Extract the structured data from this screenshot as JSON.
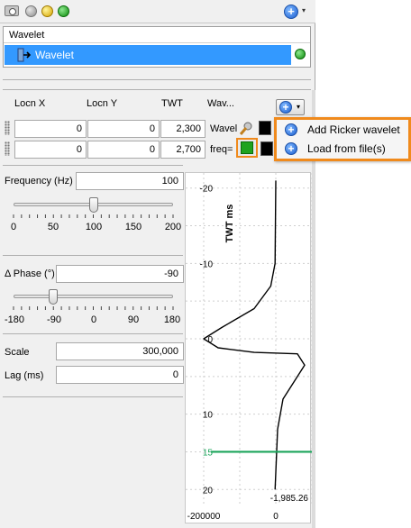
{
  "toolbar": {
    "add_label": "+",
    "dropdown_arrow": "▾"
  },
  "wavelet_list": {
    "header": "Wavelet",
    "items": [
      {
        "label": "Wavelet",
        "selected": true,
        "status": "green"
      }
    ]
  },
  "table": {
    "headers": [
      "Locn X",
      "Locn Y",
      "TWT",
      "Wav..."
    ],
    "rows": [
      {
        "x": "0",
        "y": "0",
        "twt": "2,300",
        "wav": "Wavel"
      },
      {
        "x": "0",
        "y": "0",
        "twt": "2,700",
        "wav": "freq="
      }
    ]
  },
  "add_menu": {
    "items": [
      {
        "label": "Add Ricker wavelet",
        "icon": "add-icon"
      },
      {
        "label": "Load from file(s)",
        "icon": "add-icon"
      }
    ]
  },
  "frequency": {
    "label": "Frequency (Hz)",
    "value": "100",
    "ticks": [
      "0",
      "50",
      "100",
      "150",
      "200"
    ],
    "level_fraction": 0.5
  },
  "phase": {
    "label": "Δ Phase (°)",
    "value": "-90",
    "ticks": [
      "-180",
      "-90",
      "0",
      "90",
      "180"
    ],
    "level_fraction": 0.25
  },
  "scale": {
    "label": "Scale",
    "value": "300,000"
  },
  "lag": {
    "label": "Lag (ms)",
    "value": "0"
  },
  "plot": {
    "ylabel": "TWT ms",
    "y_ticks": [
      "-20",
      "-10",
      "0",
      "10",
      "15",
      "20"
    ],
    "x_ticks": [
      "-200000",
      "0"
    ],
    "readout": "-1,985.26",
    "marker_value": "15",
    "marker_color": "#1aa45a"
  },
  "colors": {
    "selection": "#3399ff",
    "highlight_border": "#f08a1c",
    "status_green": "#0a8a0a"
  },
  "chart_data": {
    "type": "line",
    "title": "",
    "xlabel": "",
    "ylabel": "TWT ms",
    "ylim": [
      -22,
      22
    ],
    "xlim": [
      -250000,
      100000
    ],
    "x": [
      0,
      -1986,
      -14000,
      -60000,
      -150000,
      -200000,
      -160000,
      -60000,
      60000,
      80000,
      20000,
      5000,
      -1986
    ],
    "y": [
      -21,
      -10,
      -7,
      -4,
      -1.5,
      0,
      1.2,
      1.8,
      2,
      3.5,
      8,
      12,
      20
    ],
    "marker_line": 15,
    "grid": true
  }
}
